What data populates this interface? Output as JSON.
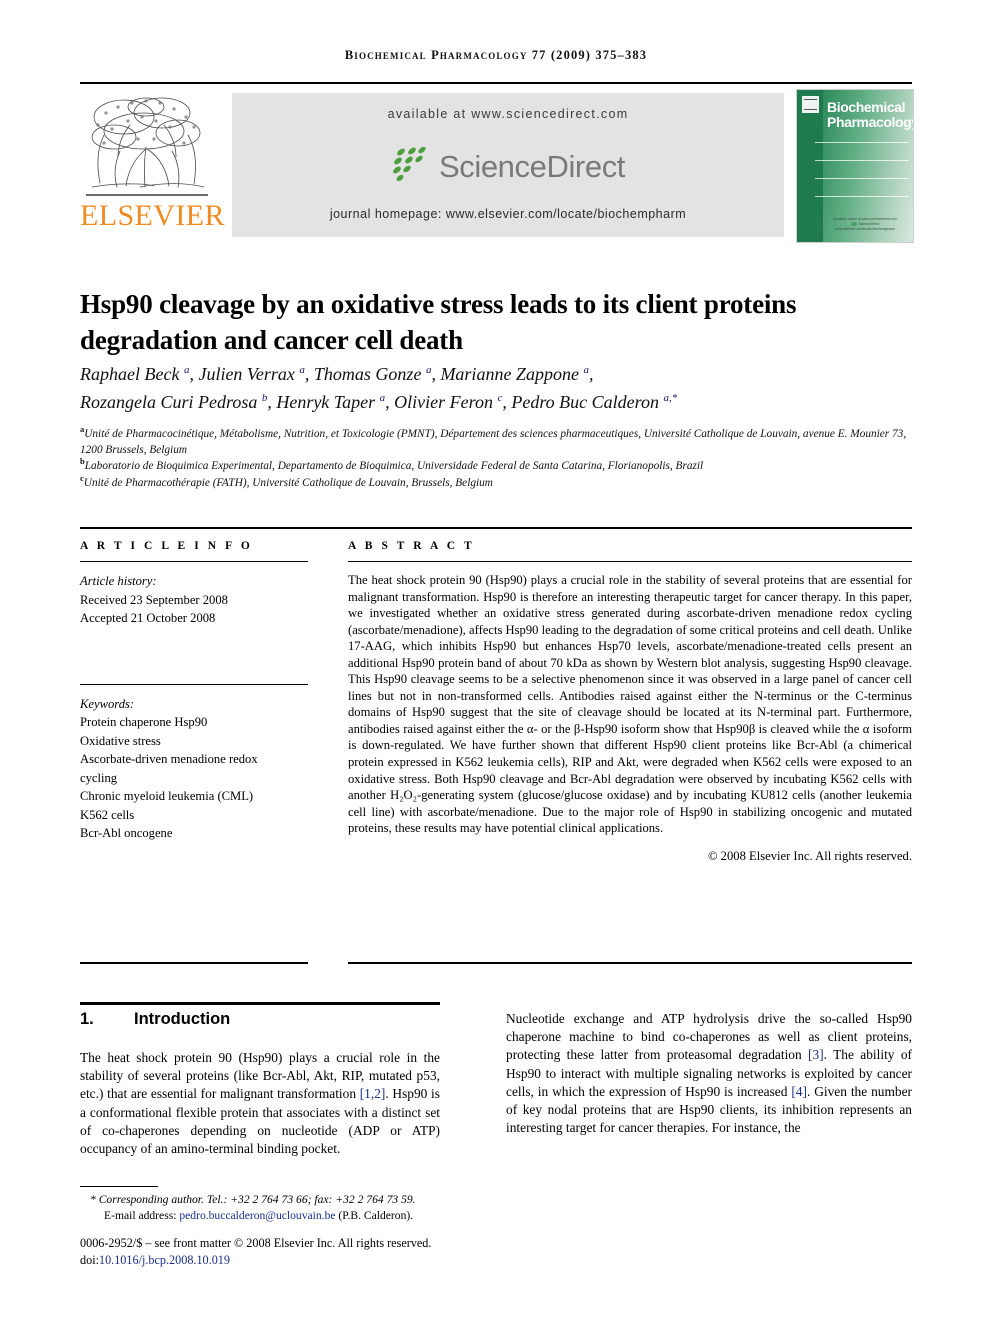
{
  "running_head": "Biochemical Pharmacology 77 (2009) 375–383",
  "masthead": {
    "publisher": "ELSEVIER",
    "available_at": "available at www.sciencedirect.com",
    "sciencedirect_wordmark": "ScienceDirect",
    "journal_homepage": "journal homepage: www.elsevier.com/locate/biochempharm",
    "cover": {
      "title_line1": "Biochemical",
      "title_line2": "Pharmacology",
      "footer_line1": "Available online at www.sciencedirect.com",
      "footer_line2": "ScienceDirect",
      "footer_line3": "www.elsevier.com/locate/biochempharm"
    },
    "colors": {
      "elsevier_orange": "#F08A22",
      "band_gray": "#E3E3E3",
      "sciencedirect_gray": "#7A7A7A",
      "sciencedirect_green": "#4E9E3E",
      "cover_green": "#1F7A4D"
    }
  },
  "article": {
    "title": "Hsp90 cleavage by an oxidative stress leads to its client proteins degradation and cancer cell death",
    "authors_line1": "Raphael Beck <sup>a</sup>, Julien Verrax <sup>a</sup>, Thomas Gonze <sup>a</sup>, Marianne Zappone <sup>a</sup>,",
    "authors_line2": "Rozangela Curi Pedrosa <sup>b</sup>, Henryk Taper <sup>a</sup>, Olivier Feron <sup>c</sup>, Pedro Buc Calderon <sup>a,*</sup>",
    "affiliations": [
      "<sup>a</sup>Unité de Pharmacocinétique, Métabolisme, Nutrition, et Toxicologie (PMNT), Département des sciences pharmaceutiques, Université Catholique de Louvain, avenue E. Mounier 73, 1200 Brussels, Belgium",
      "<sup>b</sup>Laboratorio de Bioquimica Experimental, Departamento de Bioquimica, Universidade Federal de Santa Catarina, Florianopolis, Brazil",
      "<sup>c</sup>Unité de Pharmacothérapie (FATH), Université Catholique de Louvain, Brussels, Belgium"
    ]
  },
  "article_info": {
    "heading": "A R T I C L E   I N F O",
    "history_label": "Article history:",
    "history": [
      "Received 23 September 2008",
      "Accepted 21 October 2008"
    ],
    "keywords_label": "Keywords:",
    "keywords": [
      "Protein chaperone Hsp90",
      "Oxidative stress",
      "Ascorbate-driven menadione redox",
      "cycling",
      "Chronic myeloid leukemia (CML)",
      "K562 cells",
      "Bcr-Abl oncogene"
    ]
  },
  "abstract": {
    "heading": "A B S T R A C T",
    "text": "The heat shock protein 90 (Hsp90) plays a crucial role in the stability of several proteins that are essential for malignant transformation. Hsp90 is therefore an interesting therapeutic target for cancer therapy. In this paper, we investigated whether an oxidative stress generated during ascorbate-driven menadione redox cycling (ascorbate/menadione), affects Hsp90 leading to the degradation of some critical proteins and cell death. Unlike 17-AAG, which inhibits Hsp90 but enhances Hsp70 levels, ascorbate/menadione-treated cells present an additional Hsp90 protein band of about 70 kDa as shown by Western blot analysis, suggesting Hsp90 cleavage. This Hsp90 cleavage seems to be a selective phenomenon since it was observed in a large panel of cancer cell lines but not in non-transformed cells. Antibodies raised against either the N-terminus or the C-terminus domains of Hsp90 suggest that the site of cleavage should be located at its N-terminal part. Furthermore, antibodies raised against either the α- or the β-Hsp90 isoform show that Hsp90β is cleaved while the α isoform is down-regulated. We have further shown that different Hsp90 client proteins like Bcr-Abl (a chimerical protein expressed in K562 leukemia cells), RIP and Akt, were degraded when K562 cells were exposed to an oxidative stress. Both Hsp90 cleavage and Bcr-Abl degradation were observed by incubating K562 cells with another H₂O₂-generating system (glucose/glucose oxidase) and by incubating KU812 cells (another leukemia cell line) with ascorbate/menadione. Due to the major role of Hsp90 in stabilizing oncogenic and mutated proteins, these results may have potential clinical applications.",
    "copyright": "© 2008 Elsevier Inc. All rights reserved."
  },
  "body": {
    "section_number": "1.",
    "section_title": "Introduction",
    "left_paragraph_html": "The heat shock protein 90 (Hsp90) plays a crucial role in the stability of several proteins (like Bcr-Abl, Akt, RIP, mutated p53, etc.) that are essential for malignant transformation <span class=\"ref\">[1,2]</span>. Hsp90 is a conformational flexible protein that associates with a distinct set of co-chaperones depending on nucleotide (ADP or ATP) occupancy of an amino-terminal binding pocket.",
    "right_paragraph_html": "Nucleotide exchange and ATP hydrolysis drive the so-called Hsp90 chaperone machine to bind co-chaperones as well as client proteins, protecting these latter from proteasomal degradation <span class=\"ref\">[3]</span>. The ability of Hsp90 to interact with multiple signaling networks is exploited by cancer cells, in which the expression of Hsp90 is increased <span class=\"ref\">[4]</span>. Given the number of key nodal proteins that are Hsp90 clients, its inhibition represents an interesting target for cancer therapies. For instance, the"
  },
  "footnotes": {
    "corresponding_html": "<span style=\"font-style:italic\">* Corresponding author.</span> Tel.: +32 2 764 73 66; fax: +32 2 764 73 59.",
    "email_html": "E-mail address: <span class=\"link\">pedro.buccalderon@uclouvain.be</span> (P.B. Calderon).",
    "issn_html": "0006-2952/$ – see front matter © 2008 Elsevier Inc. All rights reserved.",
    "doi_html": "doi:<span class=\"link\">10.1016/j.bcp.2008.10.019</span>"
  }
}
